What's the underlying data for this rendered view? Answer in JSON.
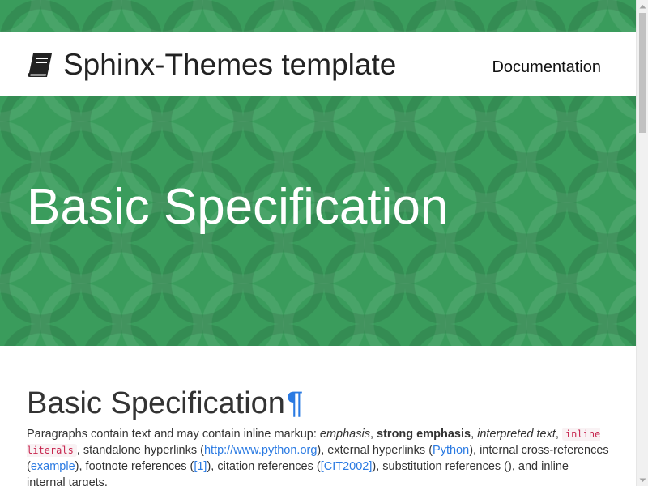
{
  "navbar": {
    "brand_icon": "book-icon",
    "brand_text": "Sphinx-Themes template",
    "documentation_link": "Documentation"
  },
  "hero": {
    "title": "Basic Specification"
  },
  "content": {
    "heading": "Basic Specification",
    "headerlink": "¶",
    "paragraph": {
      "t1": "Paragraphs contain text and may contain inline markup: ",
      "emphasis": "emphasis",
      "t2": ", ",
      "strong": "strong emphasis",
      "t3": ", ",
      "interpreted": "interpreted text",
      "t4": ", ",
      "literals": "inline literals",
      "t5": ", standalone hyperlinks (",
      "link_python_org": "http://www.python.org",
      "t6": "), external hyperlinks (",
      "link_python": "Python",
      "t7": "), internal cross-references (",
      "link_example": "example",
      "t8": "), footnote references (",
      "link_footnote": "[1]",
      "t9": "), citation references (",
      "link_citation": "[CIT2002]",
      "t10": "), substitution references (), and inline internal targets."
    }
  },
  "colors": {
    "hero_green": "#3a9c5c",
    "link_blue": "#2a7ae2",
    "literal_red": "#c7254e"
  },
  "scrollbar": {
    "up_icon": "arrow-up-icon",
    "down_icon": "arrow-down-icon"
  }
}
